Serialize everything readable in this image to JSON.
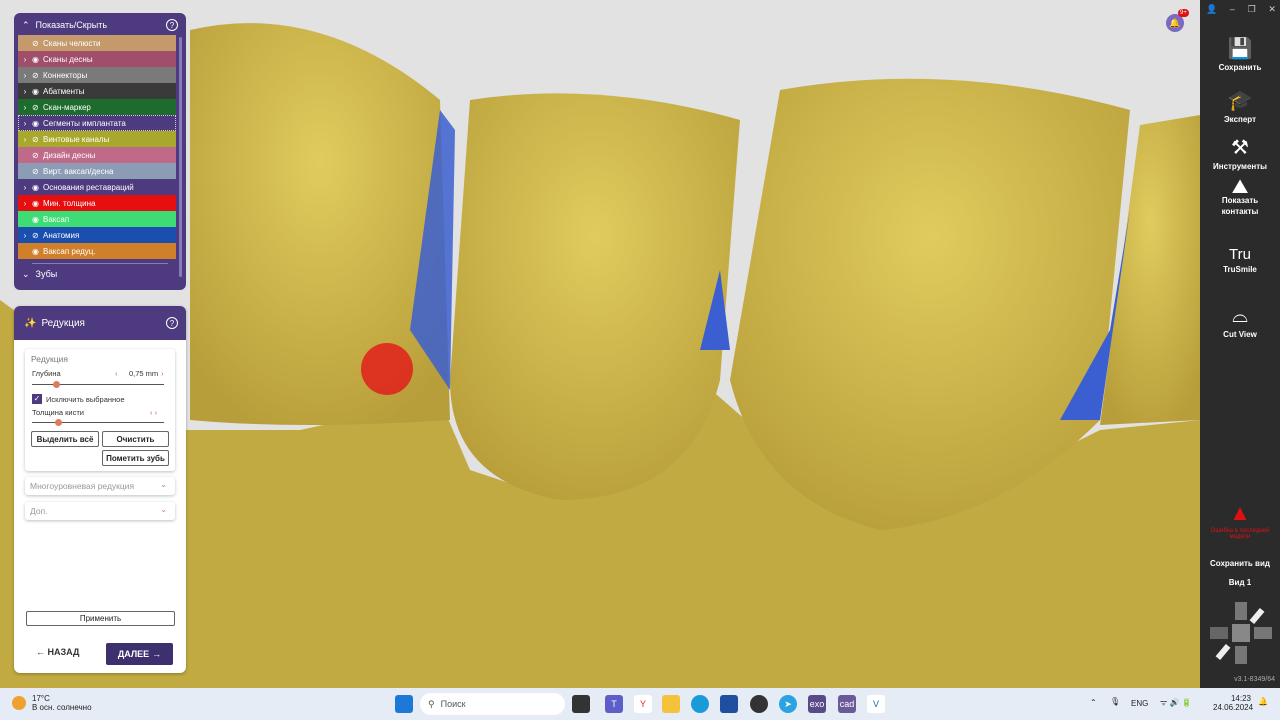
{
  "layers_panel": {
    "title": "Показать/Скрыть",
    "help": "?",
    "items": [
      {
        "label": "Сканы челюсти",
        "color": "#c49a6c",
        "expand": false,
        "visible": false
      },
      {
        "label": "Сканы десны",
        "color": "#a04e6a",
        "expand": true,
        "visible": true
      },
      {
        "label": "Коннекторы",
        "color": "#7a7a7a",
        "expand": true,
        "visible": false
      },
      {
        "label": "Абатменты",
        "color": "#3a3a3a",
        "expand": true,
        "visible": true
      },
      {
        "label": "Скан-маркер",
        "color": "#1e6b2e",
        "expand": true,
        "visible": false
      },
      {
        "label": "Сегменты имплантата",
        "color": "#4e3a7e",
        "expand": true,
        "visible": true,
        "selected": true
      },
      {
        "label": "Винтовые каналы",
        "color": "#a8a82c",
        "expand": true,
        "visible": false
      },
      {
        "label": "Дизайн десны",
        "color": "#c06a8a",
        "expand": false,
        "visible": false
      },
      {
        "label": "Вирт. ваксап/десна",
        "color": "#8c9cb4",
        "expand": false,
        "visible": false
      },
      {
        "label": "Основания реставраций",
        "color": "#4e3a7e",
        "expand": true,
        "visible": true
      },
      {
        "label": "Мин. толщина",
        "color": "#e50f0f",
        "expand": true,
        "visible": true
      },
      {
        "label": "Ваксап",
        "color": "#3ddc74",
        "expand": false,
        "visible": true
      },
      {
        "label": "Анатомия",
        "color": "#1a4fb0",
        "expand": true,
        "visible": false
      },
      {
        "label": "Ваксап редуц.",
        "color": "#d0802a",
        "expand": false,
        "visible": true
      }
    ],
    "teeth_label": "Зубы"
  },
  "reduction_panel": {
    "title": "Редукция",
    "help": "?",
    "section": "Редукция",
    "depth_label": "Глубина",
    "depth_value": "0,75 mm",
    "depth_fraction": 0.18,
    "exclude_label": "Исключить выбранное",
    "exclude_checked": true,
    "brush_label": "Толщина кисти",
    "brush_fraction": 0.2,
    "select_all": "Выделить всё",
    "clear": "Очистить",
    "mark_teeth": "Пометить зубь",
    "multilevel": "Многоуровневая редукция",
    "extra": "Доп.",
    "apply": "Применить",
    "back": "НАЗАД",
    "next": "ДАЛЕЕ"
  },
  "right_toolbar": {
    "tools": [
      {
        "label": "Сохранить"
      },
      {
        "label": "Эксперт"
      },
      {
        "label": "Инструменты"
      },
      {
        "label": "Показать контакты"
      },
      {
        "label": "TruSmile"
      },
      {
        "label": "Cut View"
      }
    ],
    "warning": "Ошибка в последней модели",
    "save_view": "Сохранить вид",
    "view": "Вид 1",
    "version": "v3.1-8349/64",
    "notification_badge": "9+"
  },
  "taskbar": {
    "weather_temp": "17°C",
    "weather_desc": "В осн. солнечно",
    "search": "Поиск",
    "lang": "ENG",
    "time": "14:23",
    "date": "24.06.2024"
  }
}
